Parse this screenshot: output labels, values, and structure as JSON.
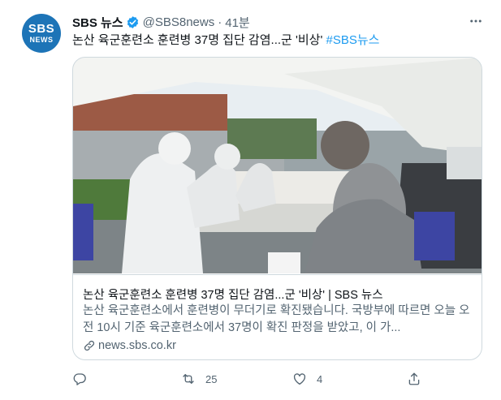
{
  "account": {
    "avatar_line1": "SBS",
    "avatar_line2": "NEWS",
    "name": "SBS 뉴스",
    "handle": "@SBS8news",
    "separator": "·",
    "time": "41분"
  },
  "tweet": {
    "text": "논산 육군훈련소 훈련병 37명 집단 감염...군 '비상'",
    "hashtag": "#SBS뉴스"
  },
  "card": {
    "title": "논산 육군훈련소 훈련병 37명 집단 감염...군 '비상' | SBS 뉴스",
    "description": "논산 육군훈련소에서 훈련병이 무더기로 확진됐습니다. 국방부에 따르면 오늘 오전 10시 기준 육군훈련소에서 37명이 확진 판정을 받았고, 이 가...",
    "domain": "news.sbs.co.kr"
  },
  "actions": {
    "reply_count": "",
    "retweet_count": "25",
    "like_count": "4"
  },
  "colors": {
    "brand_blue": "#1d9bf0",
    "avatar_blue": "#1d74b7",
    "text_primary": "#0f1419",
    "text_secondary": "#536471",
    "border": "#cfd9de"
  },
  "icons": [
    "verified-badge-icon",
    "more-icon",
    "link-icon",
    "reply-icon",
    "retweet-icon",
    "like-icon",
    "share-icon"
  ]
}
